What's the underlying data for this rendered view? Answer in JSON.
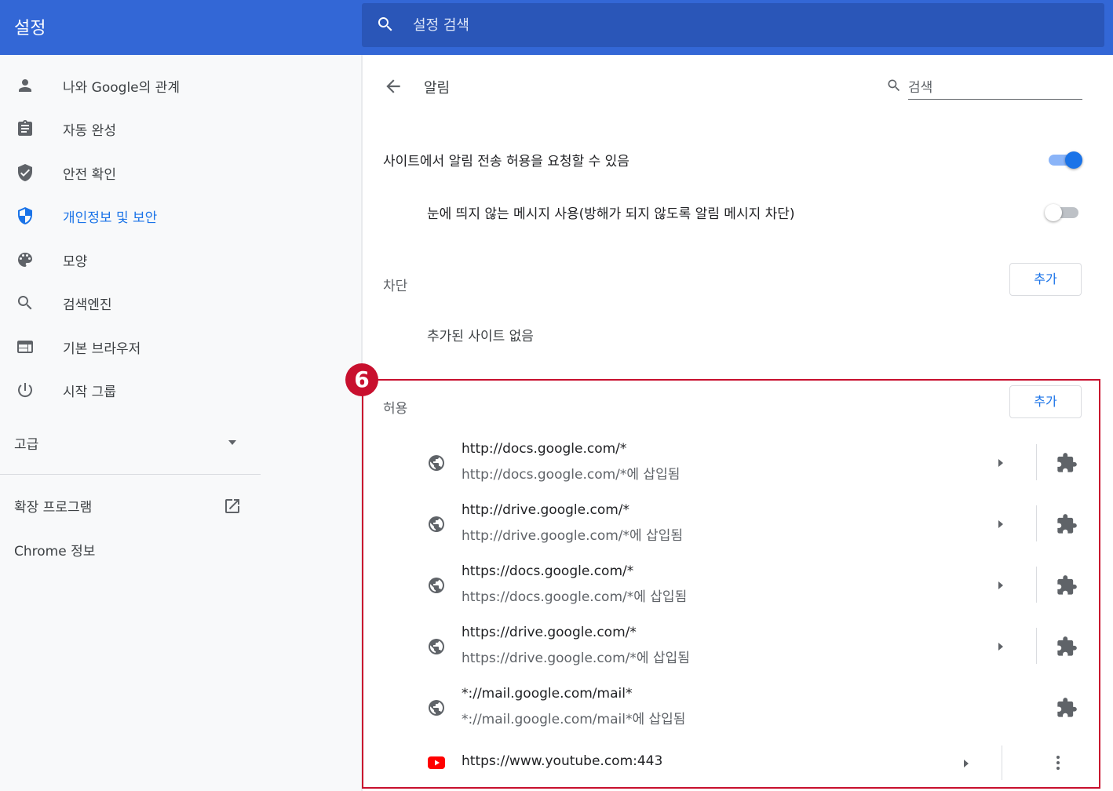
{
  "header": {
    "title": "설정",
    "search_placeholder": "설정 검색"
  },
  "sidebar": {
    "items": [
      {
        "label": "나와 Google의 관계",
        "icon": "person-icon",
        "active": false
      },
      {
        "label": "자동 완성",
        "icon": "clipboard-icon",
        "active": false
      },
      {
        "label": "안전 확인",
        "icon": "shield-check-icon",
        "active": false
      },
      {
        "label": "개인정보 및 보안",
        "icon": "shield-icon",
        "active": true
      },
      {
        "label": "모양",
        "icon": "palette-icon",
        "active": false
      },
      {
        "label": "검색엔진",
        "icon": "search-icon",
        "active": false
      },
      {
        "label": "기본 브라우저",
        "icon": "browser-icon",
        "active": false
      },
      {
        "label": "시작 그룹",
        "icon": "power-icon",
        "active": false
      }
    ],
    "advanced_label": "고급",
    "extensions_label": "확장 프로그램",
    "about_label": "Chrome 정보"
  },
  "main": {
    "title": "알림",
    "search_placeholder": "검색",
    "ask_label": "사이트에서 알림 전송 허용을 요청할 수 있음",
    "ask_enabled": true,
    "quiet_label": "눈에 띄지 않는 메시지 사용(방해가 되지 않도록 알림 메시지 차단)",
    "quiet_enabled": false,
    "block": {
      "heading": "차단",
      "add_label": "추가",
      "empty_text": "추가된 사이트 없음"
    },
    "allow": {
      "heading": "허용",
      "add_label": "추가",
      "sites": [
        {
          "url": "http://docs.google.com/*",
          "sub": "http://docs.google.com/*에 삽입됨",
          "has_arrow": true
        },
        {
          "url": "http://drive.google.com/*",
          "sub": "http://drive.google.com/*에 삽입됨",
          "has_arrow": true
        },
        {
          "url": "https://docs.google.com/*",
          "sub": "https://docs.google.com/*에 삽입됨",
          "has_arrow": true
        },
        {
          "url": "https://drive.google.com/*",
          "sub": "https://drive.google.com/*에 삽입됨",
          "has_arrow": true
        },
        {
          "url": "*://mail.google.com/mail*",
          "sub": "*://mail.google.com/mail*에 삽입됨",
          "has_arrow": false
        }
      ],
      "youtube": {
        "url": "https://www.youtube.com:443"
      }
    },
    "step_badge": "6"
  },
  "colors": {
    "header_bg": "#3367d6",
    "accent": "#1a73e8",
    "highlight": "#c8102e"
  }
}
